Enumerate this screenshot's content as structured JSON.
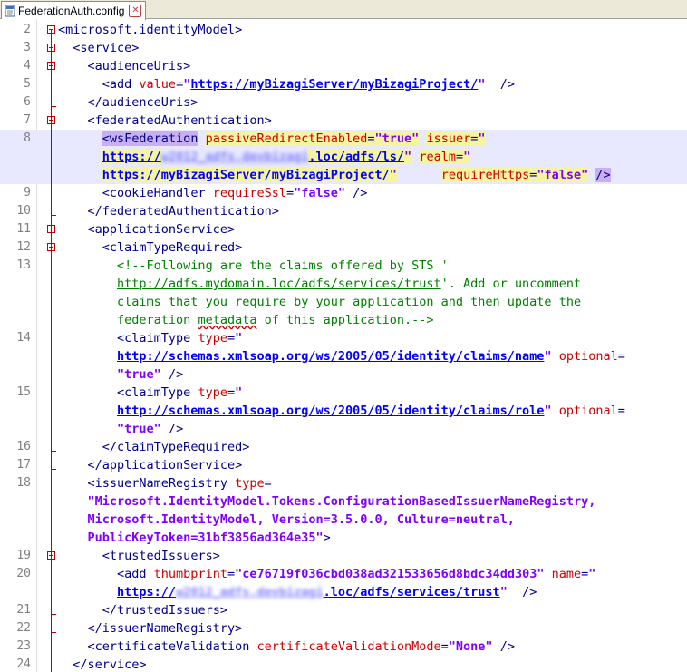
{
  "tab": {
    "title": "FederationAuth.config"
  },
  "lines": [
    {
      "ln": "2",
      "row": 0,
      "fold": true,
      "segs": [
        [
          "t",
          "<microsoft.identityModel>"
        ]
      ]
    },
    {
      "ln": "3",
      "row": 1,
      "fold": true,
      "segs": [
        [
          "p",
          "  "
        ],
        [
          "t",
          "<service>"
        ]
      ]
    },
    {
      "ln": "4",
      "row": 2,
      "fold": true,
      "segs": [
        [
          "p",
          "    "
        ],
        [
          "t",
          "<audienceUris>"
        ]
      ]
    },
    {
      "ln": "5",
      "row": 3,
      "segs": [
        [
          "p",
          "      "
        ],
        [
          "t",
          "<add "
        ],
        [
          "a",
          "value"
        ],
        [
          "t",
          "="
        ],
        [
          "v",
          "\""
        ],
        [
          "u",
          "https://myBizagiServer/myBizagiProject/"
        ],
        [
          "v",
          "\""
        ],
        [
          "t",
          "  />"
        ]
      ]
    },
    {
      "ln": "6",
      "row": 4,
      "segs": [
        [
          "p",
          "    "
        ],
        [
          "t",
          "</audienceUris>"
        ]
      ]
    },
    {
      "ln": "7",
      "row": 5,
      "fold": true,
      "segs": [
        [
          "p",
          "    "
        ],
        [
          "t",
          "<federatedAuthentication>"
        ]
      ]
    },
    {
      "ln": "8",
      "row": 6,
      "hl": true,
      "segs": [
        [
          "p",
          "      "
        ],
        [
          "tmp",
          "<wsFederation"
        ],
        [
          "p",
          " "
        ],
        [
          "am",
          "passiveRedirectEnabled"
        ],
        [
          "tm",
          "="
        ],
        [
          "vm",
          "\"true\""
        ],
        [
          "p",
          " "
        ],
        [
          "am",
          "issuer"
        ],
        [
          "tm",
          "="
        ],
        [
          "vm",
          "\""
        ]
      ]
    },
    {
      "ln": "",
      "row": 7,
      "hl": true,
      "segs": [
        [
          "p",
          "      "
        ],
        [
          "um",
          "https://"
        ],
        [
          "blur",
          "w2012_adfs.devbizagi"
        ],
        [
          "um",
          ".loc/adfs/ls/"
        ],
        [
          "vm",
          "\""
        ],
        [
          "p",
          " "
        ],
        [
          "am",
          "realm"
        ],
        [
          "tm",
          "="
        ],
        [
          "vm",
          "\""
        ]
      ]
    },
    {
      "ln": "",
      "row": 8,
      "hl": true,
      "segs": [
        [
          "p",
          "      "
        ],
        [
          "um",
          "https://myBizagiServer/myBizagiProject/"
        ],
        [
          "vm",
          "\""
        ],
        [
          "p",
          "      "
        ],
        [
          "am",
          "requireHttps"
        ],
        [
          "tm",
          "="
        ],
        [
          "vm",
          "\"false\""
        ],
        [
          "p",
          " "
        ],
        [
          "tmp",
          "/>"
        ]
      ]
    },
    {
      "ln": "9",
      "row": 9,
      "segs": [
        [
          "p",
          "      "
        ],
        [
          "t",
          "<cookieHandler "
        ],
        [
          "a",
          "requireSsl"
        ],
        [
          "t",
          "="
        ],
        [
          "v",
          "\"false\""
        ],
        [
          "t",
          " />"
        ]
      ]
    },
    {
      "ln": "10",
      "row": 10,
      "segs": [
        [
          "p",
          "    "
        ],
        [
          "t",
          "</federatedAuthentication>"
        ]
      ]
    },
    {
      "ln": "11",
      "row": 11,
      "fold": true,
      "segs": [
        [
          "p",
          "    "
        ],
        [
          "t",
          "<applicationService>"
        ]
      ]
    },
    {
      "ln": "12",
      "row": 12,
      "fold": true,
      "segs": [
        [
          "p",
          "      "
        ],
        [
          "t",
          "<claimTypeRequired>"
        ]
      ]
    },
    {
      "ln": "13",
      "row": 13,
      "segs": [
        [
          "p",
          "        "
        ],
        [
          "c",
          "<!--Following are the claims offered by STS '"
        ]
      ]
    },
    {
      "ln": "",
      "row": 14,
      "segs": [
        [
          "p",
          "        "
        ],
        [
          "cu",
          "http://adfs.mydomain.loc/adfs/services/trust"
        ],
        [
          "c",
          "'. Add or uncomment"
        ]
      ]
    },
    {
      "ln": "",
      "row": 15,
      "segs": [
        [
          "p",
          "        "
        ],
        [
          "c",
          "claims that you require by your application and then update the"
        ]
      ]
    },
    {
      "ln": "",
      "row": 16,
      "segs": [
        [
          "p",
          "        "
        ],
        [
          "c",
          "federation "
        ],
        [
          "sq",
          "metadata"
        ],
        [
          "c",
          " of this application.-->"
        ]
      ]
    },
    {
      "ln": "14",
      "row": 17,
      "segs": [
        [
          "p",
          "        "
        ],
        [
          "t",
          "<claimType "
        ],
        [
          "a",
          "type"
        ],
        [
          "t",
          "="
        ],
        [
          "v",
          "\""
        ]
      ]
    },
    {
      "ln": "",
      "row": 18,
      "segs": [
        [
          "p",
          "        "
        ],
        [
          "u",
          "http://schemas.xmlsoap.org/ws/2005/05/identity/claims/name"
        ],
        [
          "v",
          "\""
        ],
        [
          "p",
          " "
        ],
        [
          "a",
          "optional"
        ],
        [
          "t",
          "="
        ]
      ]
    },
    {
      "ln": "",
      "row": 19,
      "segs": [
        [
          "p",
          "        "
        ],
        [
          "v",
          "\"true\""
        ],
        [
          "t",
          " />"
        ]
      ]
    },
    {
      "ln": "15",
      "row": 20,
      "segs": [
        [
          "p",
          "        "
        ],
        [
          "t",
          "<claimType "
        ],
        [
          "a",
          "type"
        ],
        [
          "t",
          "="
        ],
        [
          "v",
          "\""
        ]
      ]
    },
    {
      "ln": "",
      "row": 21,
      "segs": [
        [
          "p",
          "        "
        ],
        [
          "u",
          "http://schemas.xmlsoap.org/ws/2005/05/identity/claims/role"
        ],
        [
          "v",
          "\""
        ],
        [
          "p",
          " "
        ],
        [
          "a",
          "optional"
        ],
        [
          "t",
          "="
        ]
      ]
    },
    {
      "ln": "",
      "row": 22,
      "segs": [
        [
          "p",
          "        "
        ],
        [
          "v",
          "\"true\""
        ],
        [
          "t",
          " />"
        ]
      ]
    },
    {
      "ln": "16",
      "row": 23,
      "segs": [
        [
          "p",
          "      "
        ],
        [
          "t",
          "</claimTypeRequired>"
        ]
      ]
    },
    {
      "ln": "17",
      "row": 24,
      "segs": [
        [
          "p",
          "    "
        ],
        [
          "t",
          "</applicationService>"
        ]
      ]
    },
    {
      "ln": "18",
      "row": 25,
      "segs": [
        [
          "p",
          "    "
        ],
        [
          "t",
          "<issuerNameRegistry "
        ],
        [
          "a",
          "type"
        ],
        [
          "t",
          "="
        ]
      ]
    },
    {
      "ln": "",
      "row": 26,
      "segs": [
        [
          "p",
          "    "
        ],
        [
          "v",
          "\"Microsoft.IdentityModel.Tokens.ConfigurationBasedIssuerNameRegistry,"
        ]
      ]
    },
    {
      "ln": "",
      "row": 27,
      "segs": [
        [
          "p",
          "    "
        ],
        [
          "v",
          "Microsoft.IdentityModel, Version=3.5.0.0, Culture=neutral,"
        ]
      ]
    },
    {
      "ln": "",
      "row": 28,
      "segs": [
        [
          "p",
          "    "
        ],
        [
          "v",
          "PublicKeyToken=31bf3856ad364e35\""
        ],
        [
          "t",
          ">"
        ]
      ]
    },
    {
      "ln": "19",
      "row": 29,
      "fold": true,
      "segs": [
        [
          "p",
          "      "
        ],
        [
          "t",
          "<trustedIssuers>"
        ]
      ]
    },
    {
      "ln": "20",
      "row": 30,
      "segs": [
        [
          "p",
          "        "
        ],
        [
          "t",
          "<add "
        ],
        [
          "a",
          "thumbprint"
        ],
        [
          "t",
          "="
        ],
        [
          "v",
          "\"ce76719f036cbd038ad321533656d8bdc34dd303\""
        ],
        [
          "p",
          " "
        ],
        [
          "a",
          "name"
        ],
        [
          "t",
          "="
        ],
        [
          "v",
          "\""
        ]
      ]
    },
    {
      "ln": "",
      "row": 31,
      "segs": [
        [
          "p",
          "        "
        ],
        [
          "u",
          "https://"
        ],
        [
          "blur",
          "w2012_adfs.devbizagi"
        ],
        [
          "u",
          ".loc/adfs/services/trust"
        ],
        [
          "v",
          "\""
        ],
        [
          "t",
          "  />"
        ]
      ]
    },
    {
      "ln": "21",
      "row": 32,
      "segs": [
        [
          "p",
          "      "
        ],
        [
          "t",
          "</trustedIssuers>"
        ]
      ]
    },
    {
      "ln": "22",
      "row": 33,
      "segs": [
        [
          "p",
          "    "
        ],
        [
          "t",
          "</issuerNameRegistry>"
        ]
      ]
    },
    {
      "ln": "23",
      "row": 34,
      "segs": [
        [
          "p",
          "    "
        ],
        [
          "t",
          "<certificateValidation "
        ],
        [
          "a",
          "certificateValidationMode"
        ],
        [
          "t",
          "="
        ],
        [
          "v",
          "\"None\""
        ],
        [
          "t",
          " />"
        ]
      ]
    },
    {
      "ln": "24",
      "row": 35,
      "segs": [
        [
          "p",
          "  "
        ],
        [
          "t",
          "</service>"
        ]
      ]
    }
  ]
}
